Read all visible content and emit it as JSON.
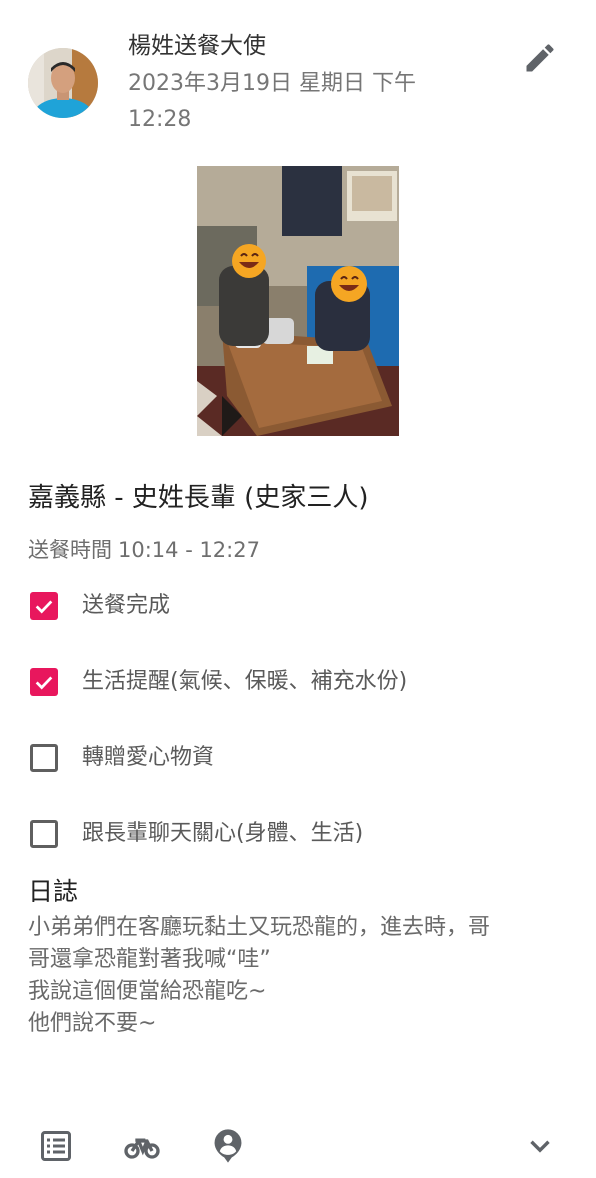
{
  "post": {
    "author": "楊姓送餐大使",
    "time_line1": "2023年3月19日 星期日 下午",
    "time_line2": "12:28"
  },
  "icons": {
    "edit": "pencil-icon",
    "list": "list-icon",
    "bike": "bicycle-icon",
    "person": "person-pin-icon",
    "expand": "chevron-down-icon"
  },
  "recipient": {
    "title": "嘉義縣 - 史姓長輩 (史家三人)"
  },
  "delivery": {
    "label": "送餐時間",
    "range": "10:14 - 12:27"
  },
  "checklist": [
    {
      "label": "送餐完成",
      "checked": true
    },
    {
      "label": "生活提醒(氣候、保暖、補充水份)",
      "checked": true
    },
    {
      "label": "轉贈愛心物資",
      "checked": false
    },
    {
      "label": "跟長輩聊天關心(身體、生活)",
      "checked": false
    }
  ],
  "log": {
    "title": "日誌",
    "lines": [
      "小弟弟們在客廳玩黏土又玩恐龍的，進去時，哥",
      "哥還拿恐龍對著我喊“哇”",
      "我說這個便當給恐龍吃~",
      "他們說不要~"
    ]
  },
  "colors": {
    "accent": "#e8175d",
    "icon": "#5f6368"
  }
}
